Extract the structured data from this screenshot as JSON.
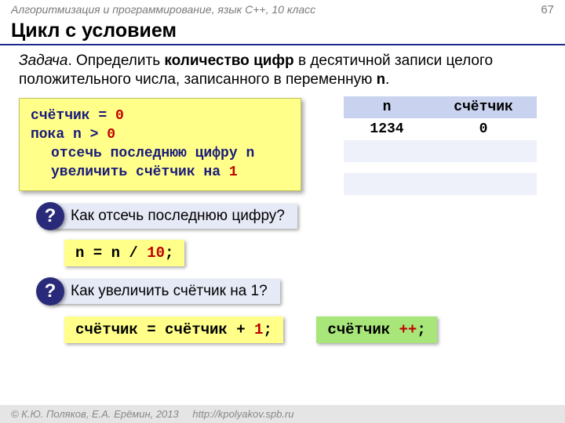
{
  "header": {
    "course": "Алгоритмизация и программирование, язык  C++, 10 класс",
    "page": "67"
  },
  "title": "Цикл с условием",
  "task": {
    "lead": "Задача",
    "text1": ". Определить ",
    "strong": "количество цифр",
    "text2": " в десятичной записи целого положительного числа, записанного в переменную ",
    "var": "n",
    "text3": "."
  },
  "algo": {
    "l1a": "счётчик = ",
    "l1b": "0",
    "l2a": "пока n > ",
    "l2b": "0",
    "l3": "отсечь последнюю цифру n",
    "l4a": "увеличить счётчик на ",
    "l4b": "1"
  },
  "trace": {
    "h_n": "n",
    "h_c": "счётчик",
    "rows": [
      {
        "n": "1234",
        "c": "0"
      },
      {
        "n": "",
        "c": ""
      },
      {
        "n": "",
        "c": ""
      },
      {
        "n": "",
        "c": ""
      },
      {
        "n": "",
        "c": ""
      }
    ]
  },
  "q1": {
    "mark": "?",
    "text": "Как отсечь последнюю цифру?"
  },
  "snip1": {
    "a": "n = n / ",
    "num": "10",
    "b": ";"
  },
  "q2": {
    "mark": "?",
    "text": "Как увеличить счётчик на 1?"
  },
  "snip2": {
    "a": "счётчик = счётчик + ",
    "num": "1",
    "b": ";"
  },
  "snip3": {
    "a": "счётчик ",
    "op": "++",
    "b": ";"
  },
  "footer": {
    "copy": "© К.Ю. Поляков, Е.А. Ерёмин, 2013",
    "link": "http://kpolyakov.spb.ru"
  }
}
